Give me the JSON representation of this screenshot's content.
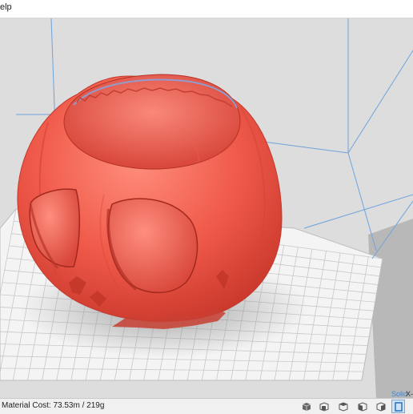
{
  "menubar": {
    "help_fragment": "elp"
  },
  "status": {
    "material_cost": "Material Cost: 73.53m / 219g",
    "view_mode": "Solid",
    "axis_fragment": "X-"
  },
  "icons": [
    "cube-front-icon",
    "cube-side-icon",
    "cube-top-icon",
    "cube-left-icon",
    "cube-right-icon",
    "view-mode-icon"
  ],
  "colors": {
    "model": "#f05a4a",
    "build_plate": "#f4f4f4",
    "grid": "#c8c8c8",
    "build_volume": "#6fa3dc",
    "accent": "#3a87d6"
  }
}
